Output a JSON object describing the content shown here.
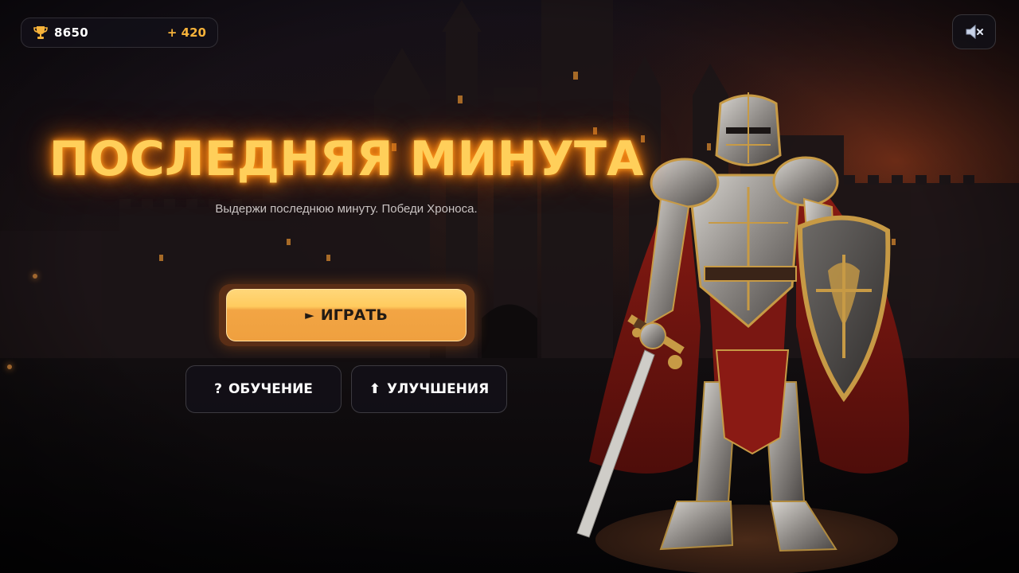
{
  "hud": {
    "score": "8650",
    "bonus": "+ 420",
    "trophy_icon": "trophy-icon",
    "sound_icon": "speaker-muted-icon"
  },
  "title": {
    "main": "ПОСЛЕДНЯЯ МИНУТА",
    "subtitle": "Выдержи последнюю минуту. Победи Хроноса."
  },
  "menu": {
    "play_icon": "►",
    "play_label": "ИГРАТЬ",
    "tutorial_icon": "?",
    "tutorial_label": "ОБУЧЕНИЕ",
    "upgrades_icon": "⬆",
    "upgrades_label": "УЛУЧШЕНИЯ"
  },
  "colors": {
    "title_glow": "#ff8a10",
    "title_fill": "#ffcf5a",
    "bonus": "#f6b23a",
    "play_button": "#efa03f"
  }
}
